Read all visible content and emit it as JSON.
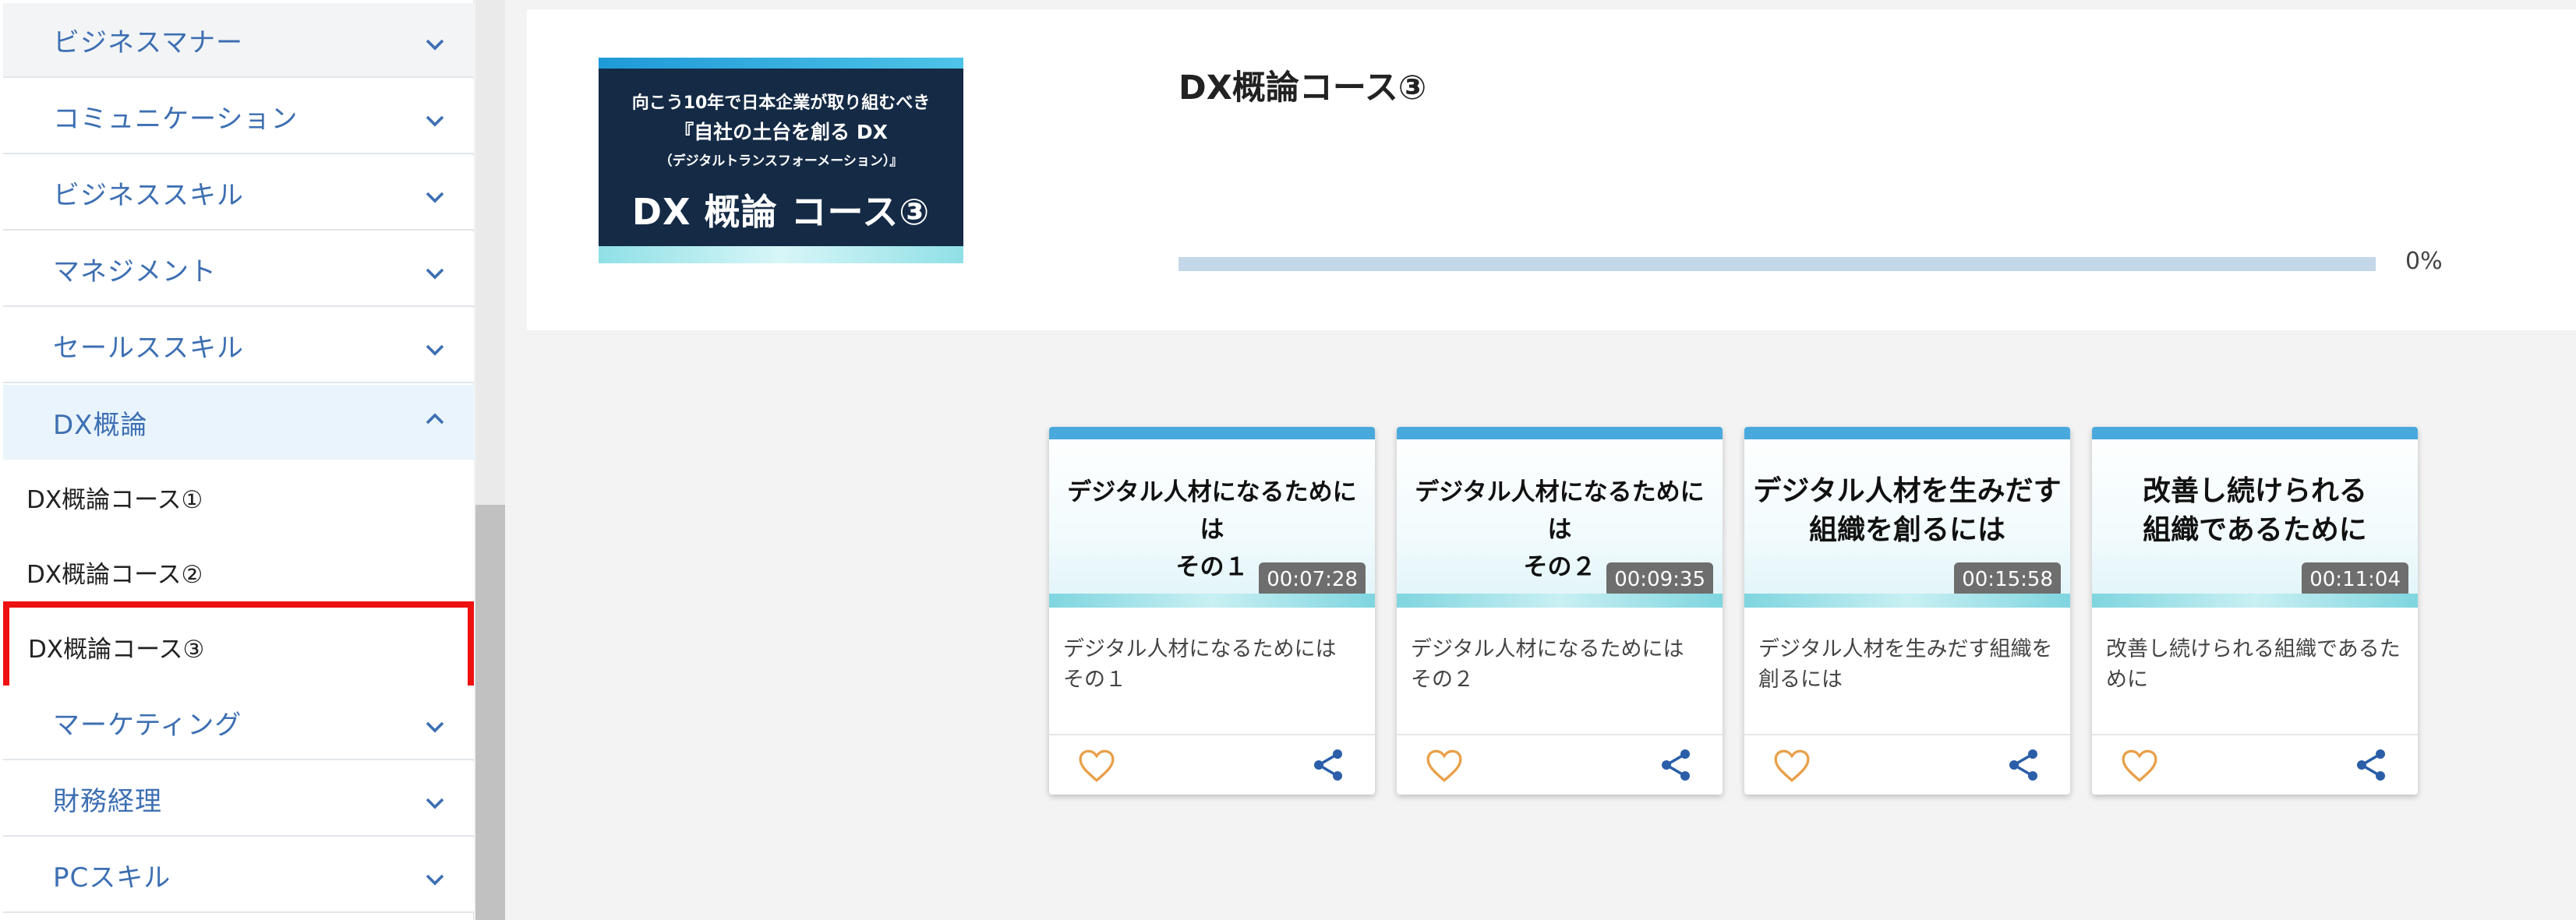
{
  "sidebar": {
    "categories_top": [
      {
        "label": "ビジネスマナー"
      },
      {
        "label": "コミュニケーション"
      },
      {
        "label": "ビジネススキル"
      },
      {
        "label": "マネジメント"
      },
      {
        "label": "セールススキル"
      }
    ],
    "active_category": {
      "label": "DX概論"
    },
    "sub_items": [
      {
        "label": "DX概論コース①"
      },
      {
        "label": "DX概論コース②"
      },
      {
        "label": "DX概論コース③"
      }
    ],
    "categories_bottom": [
      {
        "label": "マーケティング"
      },
      {
        "label": "財務経理"
      },
      {
        "label": "PCスキル"
      }
    ]
  },
  "course": {
    "banner": {
      "line1": "向こう10年で日本企業が取り組むべき",
      "line2": "『自社の土台を創る DX",
      "line3": "（デジタルトランスフォーメーション）』",
      "line4": "DX 概論 コース③"
    },
    "title": "DX概論コース③",
    "progress_value": 0,
    "progress_text": "0%"
  },
  "videos": [
    {
      "thumb_line1": "デジタル人材になるためには",
      "thumb_line2": "その１",
      "duration": "00:07:28",
      "desc": "デジタル人材になるためには その１"
    },
    {
      "thumb_line1": "デジタル人材になるためには",
      "thumb_line2": "その２",
      "duration": "00:09:35",
      "desc": "デジタル人材になるためには その２"
    },
    {
      "thumb_line1": "デジタル人材を生みだす",
      "thumb_line2": "組織を創るには",
      "duration": "00:15:58",
      "desc": "デジタル人材を生みだす組織を創るには"
    },
    {
      "thumb_line1": "改善し続けられる",
      "thumb_line2": "組織であるために",
      "duration": "00:11:04",
      "desc": "改善し続けられる組織であるために"
    }
  ],
  "colors": {
    "accent": "#3d6fb2",
    "highlight_border": "#ee1111",
    "heart": "#e8a04a",
    "share": "#2a5ea8"
  },
  "icons": {
    "category_toggle": "chevron-down-icon",
    "active_toggle": "chevron-up-icon",
    "favorite": "heart-icon",
    "share": "share-icon"
  }
}
